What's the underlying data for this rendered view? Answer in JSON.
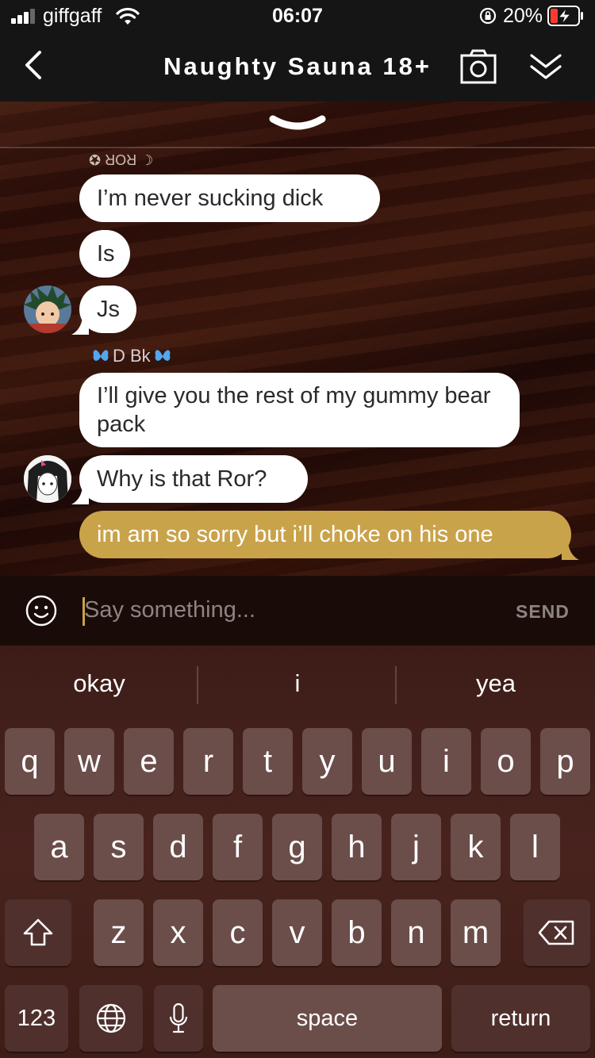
{
  "status_bar": {
    "carrier": "giffgaff",
    "time": "06:07",
    "battery": "20%",
    "icons": [
      "signal-icon",
      "wifi-icon",
      "orientation-lock-icon",
      "battery-charging-icon"
    ]
  },
  "header": {
    "title": "Naughty Sauna 18+",
    "icons": [
      "back-icon",
      "camera-icon",
      "collapse-icon"
    ]
  },
  "chat": {
    "sender_1_name_flipped": "☾ ROR ✪",
    "sender_2_name": "D Bk",
    "messages": [
      {
        "text": "I’m never sucking dick",
        "from": "other"
      },
      {
        "text": "Is",
        "from": "other"
      },
      {
        "text": "Js",
        "from": "other"
      },
      {
        "text": "I’ll give you the rest of my gummy bear pack",
        "from": "other"
      },
      {
        "text": "Why is that Ror?",
        "from": "other"
      },
      {
        "text": "im am so sorry but i’ll choke on his one",
        "from": "me"
      }
    ]
  },
  "input": {
    "placeholder": "Say something...",
    "send_label": "SEND"
  },
  "keyboard": {
    "suggestions": [
      "okay",
      "i",
      "yea"
    ],
    "row1": [
      "q",
      "w",
      "e",
      "r",
      "t",
      "y",
      "u",
      "i",
      "o",
      "p"
    ],
    "row2": [
      "a",
      "s",
      "d",
      "f",
      "g",
      "h",
      "j",
      "k",
      "l"
    ],
    "row3": [
      "z",
      "x",
      "c",
      "v",
      "b",
      "n",
      "m"
    ],
    "numbers_label": "123",
    "space_label": "space",
    "return_label": "return"
  },
  "colors": {
    "my_bubble": "#c9a34a",
    "other_bubble": "#ffffff",
    "key": "#6b4d4a",
    "key_func": "#4f302d",
    "battery_low": "#ff3b30"
  }
}
